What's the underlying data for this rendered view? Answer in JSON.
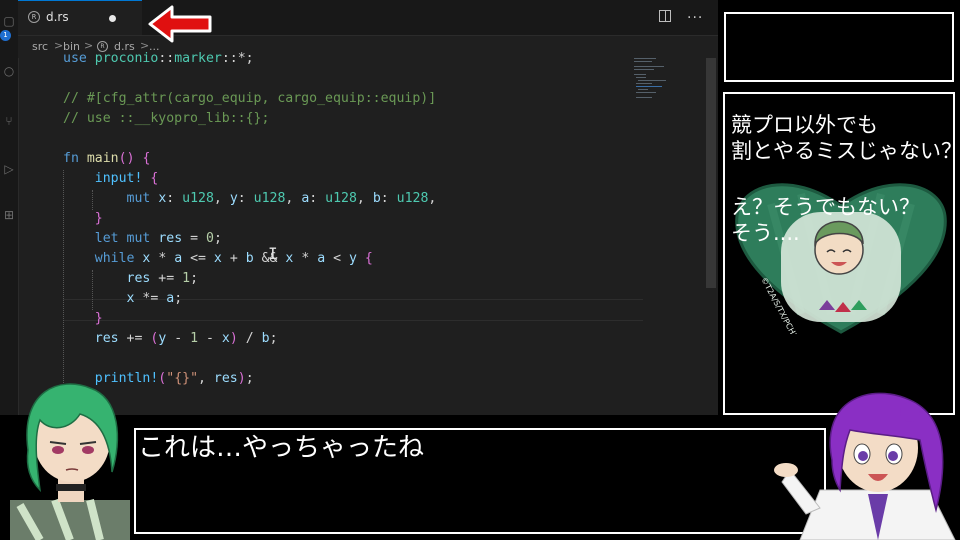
{
  "activity_bar": {
    "badge_count": "1"
  },
  "tab": {
    "filename": "d.rs",
    "rust_icon_glyph": "R"
  },
  "editor_actions": {
    "more": "..."
  },
  "breadcrumb": {
    "items": [
      "src",
      "bin",
      "d.rs",
      "..."
    ],
    "separator": ">"
  },
  "code_lines": [
    "use proconio::marker::*;",
    "",
    "// #[cfg_attr(cargo_equip, cargo_equip::equip)]",
    "// use ::__kyopro_lib::{};",
    "",
    "fn main() {",
    "    input! {",
    "        mut x: u128, y: u128, a: u128, b: u128,",
    "    }",
    "    let mut res = 0;",
    "    while x * a <= x + b && x * a < y {",
    "        res += 1;",
    "        x *= a;",
    "    }",
    "    res += (y - 1 - x) / b;",
    "",
    "    println!(\"{}\", res);"
  ],
  "side_panel": {
    "lines": [
      "競プロ以外でも",
      "割とやるミスじゃない？",
      "",
      "え？そうでもない？",
      "そう...."
    ],
    "badge_credit": "©T2A/S/TX/PCH2"
  },
  "dialogue": {
    "text": "これは…やっちゃったね"
  },
  "colors": {
    "editor_bg": "#1f1f1f",
    "arrow": "#e01010",
    "keyword": "#569cd6",
    "comment": "#6a9955",
    "badge_green": "#2e7d5b"
  }
}
